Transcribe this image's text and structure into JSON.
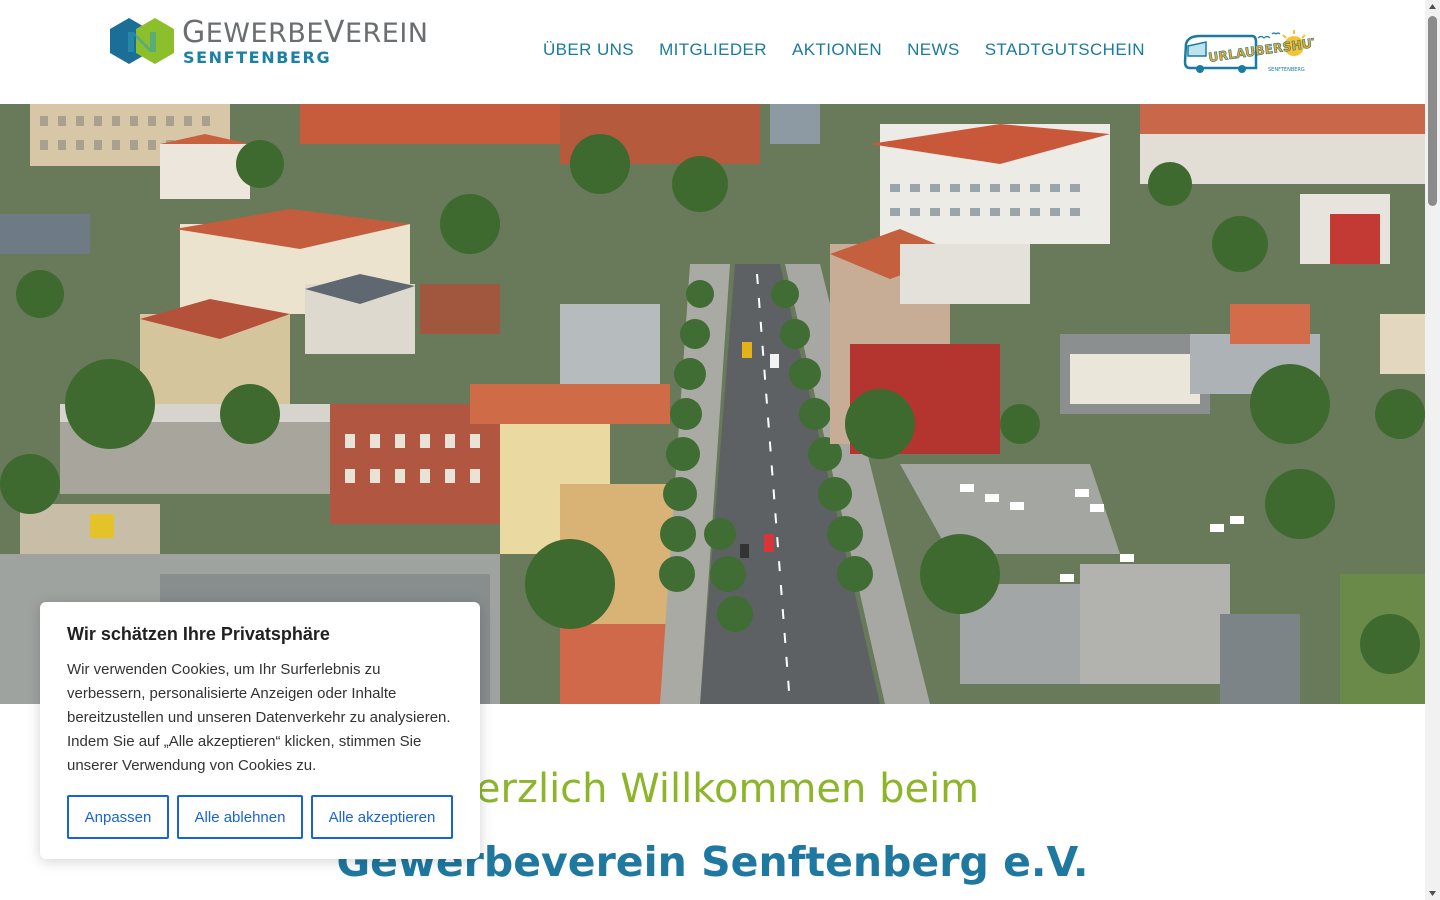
{
  "header": {
    "logo_line1_a_cap": "G",
    "logo_line1_a_rest": "EWERBE",
    "logo_line1_b_cap": "V",
    "logo_line1_b_rest": "EREIN",
    "logo_line2": "SENFTENBERG",
    "nav": [
      "ÜBER UNS",
      "MITGLIEDER",
      "AKTIONEN",
      "NEWS",
      "STADTGUTSCHEIN"
    ],
    "shuttle_logo": "URLAUBERSHUTTLE",
    "shuttle_sub": "SENFTENBERG"
  },
  "welcome": {
    "line1": "Herzlich Willkommen beim",
    "line2": "Gewerbeverein Senftenberg e.V."
  },
  "cookie": {
    "title": "Wir schätzen Ihre Privatsphäre",
    "text": "Wir verwenden Cookies, um Ihr Surferlebnis zu verbessern, personalisierte Anzeigen oder Inhalte bereitzustellen und unseren Datenverkehr zu analysieren. Indem Sie auf „Alle akzeptieren“ klicken, stimmen Sie unserer Verwendung von Cookies zu.",
    "btn_customize": "Anpassen",
    "btn_reject": "Alle ablehnen",
    "btn_accept": "Alle akzeptieren"
  },
  "colors": {
    "brand_blue": "#1b7aa0",
    "brand_green": "#8cb52a",
    "cookie_button": "#1863dc"
  }
}
